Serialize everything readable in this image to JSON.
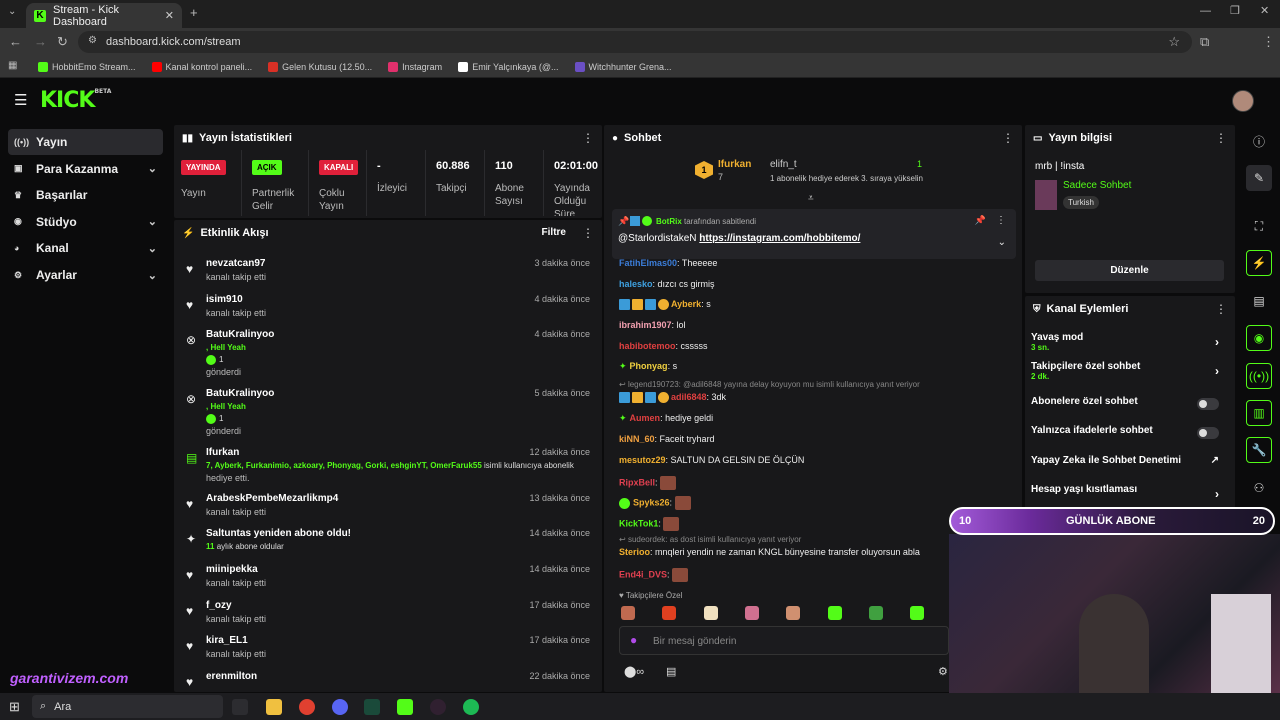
{
  "browser": {
    "tab_title": "Stream - Kick Dashboard",
    "url": "dashboard.kick.com/stream",
    "bookmarks": [
      {
        "label": "HobbitEmo Stream...",
        "color": "#53fc18"
      },
      {
        "label": "Kanal kontrol paneli...",
        "color": "#ff0000"
      },
      {
        "label": "Gelen Kutusu (12.50...",
        "color": "#d93025"
      },
      {
        "label": "Instagram",
        "color": "#e1306c"
      },
      {
        "label": "Emir Yalçınkaya (@...",
        "color": "#ffffff"
      },
      {
        "label": "Witchhunter Grena...",
        "color": "#6a4fc4"
      }
    ]
  },
  "app": {
    "logo": "KICK",
    "logo_tag": "BETA"
  },
  "sidebar": {
    "items": [
      {
        "label": "Yayın",
        "icon": "broadcast-icon"
      },
      {
        "label": "Para Kazanma",
        "icon": "wallet-icon"
      },
      {
        "label": "Başarılar",
        "icon": "trophy-icon"
      },
      {
        "label": "Stüdyo",
        "icon": "studio-icon"
      },
      {
        "label": "Kanal",
        "icon": "person-icon"
      },
      {
        "label": "Ayarlar",
        "icon": "gear-icon"
      }
    ]
  },
  "stats": {
    "title": "Yayın İstatistikleri",
    "cols": [
      {
        "badge": "YAYINDA",
        "label": "Yayın"
      },
      {
        "badge": "AÇIK",
        "label": "Partnerlik Gelir"
      },
      {
        "badge": "KAPALI",
        "label": "Çoklu Yayın"
      },
      {
        "value": "-",
        "label": "İzleyici"
      },
      {
        "value": "60.886",
        "label": "Takipçi"
      },
      {
        "value": "110",
        "label": "Abone Sayısı"
      },
      {
        "value": "02:01:00",
        "label": "Yayında Olduğu Süre"
      }
    ]
  },
  "activity": {
    "title": "Etkinlik Akışı",
    "filter": "Filtre",
    "items": [
      {
        "name": "nevzatcan97",
        "sub": "kanalı takip etti",
        "time": "3 dakika önce"
      },
      {
        "name": "isim910",
        "sub": "kanalı takip etti",
        "time": "4 dakika önce"
      },
      {
        "name": "BatuKralinyoo",
        "green": ", Hell Yeah",
        "count": "1",
        "sub": "gönderdi",
        "time": "4 dakika önce"
      },
      {
        "name": "BatuKralinyoo",
        "green": ", Hell Yeah",
        "count": "1",
        "sub": "gönderdi",
        "time": "5 dakika önce"
      },
      {
        "name": "Ifurkan",
        "green": "7, Ayberk, Furkanimio, azkoary, Phonyag, Gorki, eshginYT, OmerFaruk55",
        "green_rest": " isimli kullanıcıya abonelik",
        "sub": "hediye etti.",
        "time": "12 dakika önce"
      },
      {
        "name": "ArabeskPembeMezarlikmp4",
        "sub": "kanalı takip etti",
        "time": "13 dakika önce"
      },
      {
        "name": "Saltuntas yeniden abone oldu!",
        "green": "11",
        "green_rest": " aylık abone oldular",
        "time": "14 dakika önce"
      },
      {
        "name": "miinipekka",
        "sub": "kanalı takip etti",
        "time": "14 dakika önce"
      },
      {
        "name": "f_ozy",
        "sub": "kanalı takip etti",
        "time": "17 dakika önce"
      },
      {
        "name": "kira_EL1",
        "sub": "kanalı takip etti",
        "time": "17 dakika önce"
      },
      {
        "name": "erenmilton",
        "sub": "",
        "time": "22 dakika önce"
      }
    ]
  },
  "chat": {
    "title": "Sohbet",
    "gifter": {
      "name": "Ifurkan",
      "count": "7",
      "other": "elifn_t",
      "other_count": "1",
      "note": "1 abonelik hediye ederek 3. sıraya yükselin"
    },
    "pinned": {
      "by": "BotRix",
      "by_rest": " tarafından sabitlendi",
      "mention": "@StarlordistakeN ",
      "link": "https://instagram.com/hobbitemo/"
    },
    "messages": [
      {
        "user": "FatihElmas00",
        "color": "#3b7dd8",
        "text": "Theeeee"
      },
      {
        "user": "halesko",
        "color": "#3ea0e0",
        "text": "dızcı cs girmiş"
      },
      {
        "user": "Ayberk",
        "color": "#f0b030",
        "text": "s"
      },
      {
        "user": "ibrahim1907",
        "color": "#f2a0b0",
        "text": "lol"
      },
      {
        "user": "habibotemoo",
        "color": "#e04040",
        "text": "csssss"
      },
      {
        "user": "Phonyag",
        "color": "#f0d040",
        "text": "s"
      },
      {
        "reply": "legend190723: @adil6848 yayına delay koyuyon mu isimli kullanıcıya yanıt veriyor"
      },
      {
        "user": "adil6848",
        "color": "#e04040",
        "text": "3dk"
      },
      {
        "user": "Aumen",
        "color": "#e04040",
        "text": "hediye geldi"
      },
      {
        "user": "kiNN_60",
        "color": "#f0a040",
        "text": "Faceit tryhard"
      },
      {
        "user": "mesutoz29",
        "color": "#f0b030",
        "text": "SALTUN DA GELSIN DE ÖLÇÜN"
      },
      {
        "user": "RipxBell",
        "color": "#e04050",
        "text": ""
      },
      {
        "user": "Spyks26",
        "color": "#f0b030",
        "text": ""
      },
      {
        "user": "KickTok1",
        "color": "#53fc18",
        "text": ""
      },
      {
        "reply": "sudeordek: as dost isimli kullanıcıya yanıt veriyor"
      },
      {
        "user": "Sterioo",
        "color": "#f0b030",
        "text": "mnqleri yendin ne zaman KNGL bünyesine transfer oluyorsun abla"
      },
      {
        "user": "End4i_DVS",
        "color": "#e04050",
        "text": ""
      }
    ],
    "followers_only": "Takipçilere Özel",
    "input_placeholder": "Bir mesaj gönderin"
  },
  "stream_info": {
    "title": "Yayın bilgisi",
    "stream_title": "mrb | !insta",
    "category": "Sadece Sohbet",
    "tag": "Turkish",
    "edit": "Düzenle"
  },
  "channel_actions": {
    "title": "Kanal Eylemleri",
    "items": [
      {
        "label": "Yavaş mod",
        "sub": "3 sn."
      },
      {
        "label": "Takipçilere özel sohbet",
        "sub": "2 dk."
      },
      {
        "label": "Abonelere özel sohbet"
      },
      {
        "label": "Yalnızca ifadelerle sohbet"
      },
      {
        "label": "Yapay Zeka ile Sohbet Denetimi"
      },
      {
        "label": "Hesap yaşı kısıtlaması"
      }
    ]
  },
  "overlay": {
    "left": "10",
    "label": "GÜNLÜK ABONE",
    "right": "20",
    "watermark": "garantivizem.com"
  },
  "taskbar": {
    "search": "Ara"
  }
}
